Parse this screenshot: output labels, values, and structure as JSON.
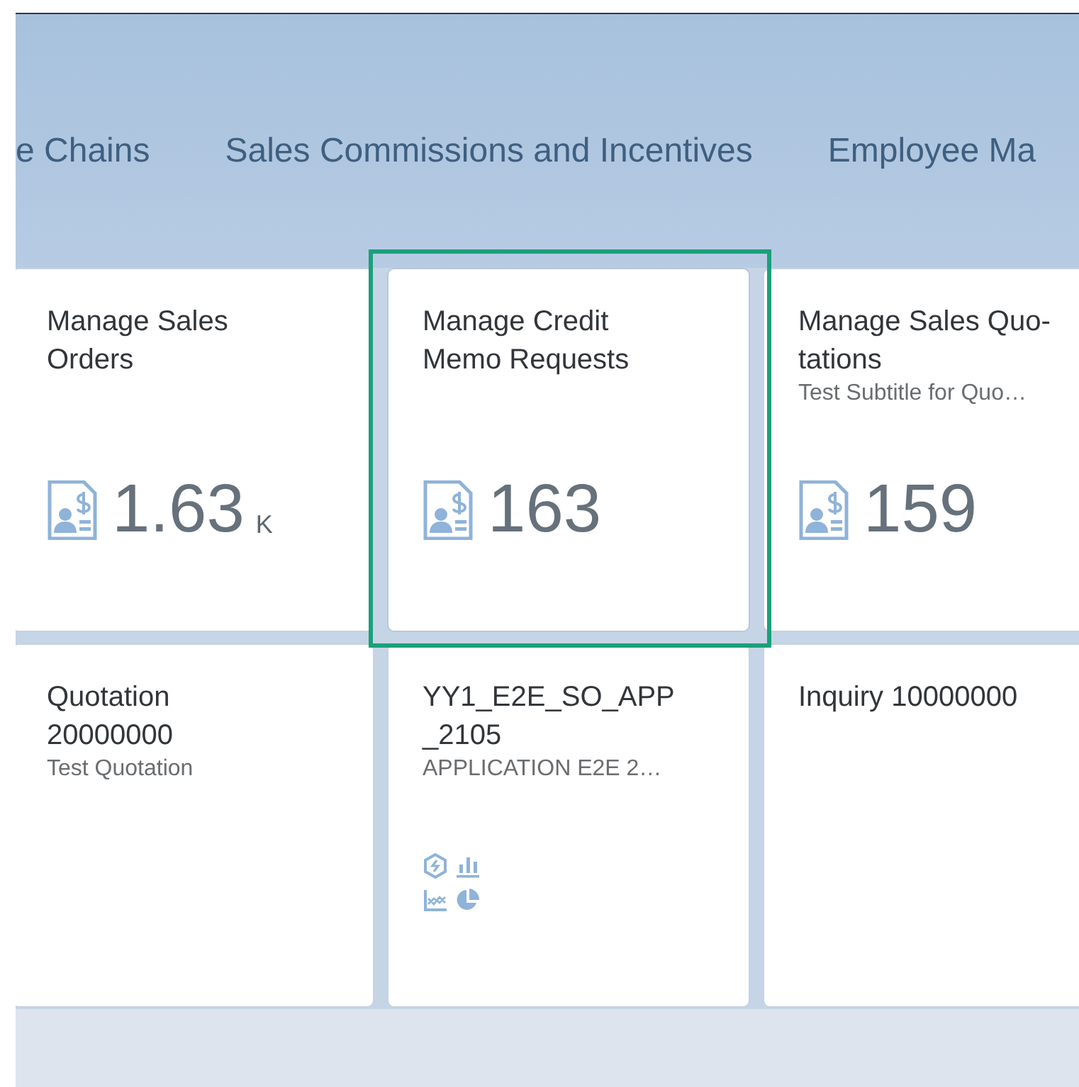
{
  "tabs": [
    {
      "label": "e Chains",
      "selected": false
    },
    {
      "label": "Sales Commissions and Incentives",
      "selected": false
    },
    {
      "label": "Employee Ma",
      "selected": false
    }
  ],
  "tiles": [
    {
      "kind": "kpi",
      "title_lines": [
        "Manage Sales",
        "Orders"
      ],
      "value": "1.63",
      "unit": "K",
      "selected": false
    },
    {
      "kind": "kpi",
      "title_lines": [
        "Manage Credit",
        "Memo Requests"
      ],
      "value": "163",
      "selected": true
    },
    {
      "kind": "kpi",
      "title_lines": [
        "Manage Sales Quo-",
        "tations"
      ],
      "subtitle": "Test Subtitle for Quo…",
      "value": "159",
      "selected": false
    },
    {
      "kind": "plain",
      "title_lines": [
        "Quotation",
        "20000000"
      ],
      "subtitle": "Test Quotation",
      "selected": false
    },
    {
      "kind": "apps",
      "title_lines": [
        "YY1_E2E_SO_APP",
        "_2105"
      ],
      "subtitle": "APPLICATION E2E 2…",
      "selected": false
    },
    {
      "kind": "plain",
      "title_lines": [
        "Inquiry 10000000"
      ],
      "selected": false
    }
  ]
}
